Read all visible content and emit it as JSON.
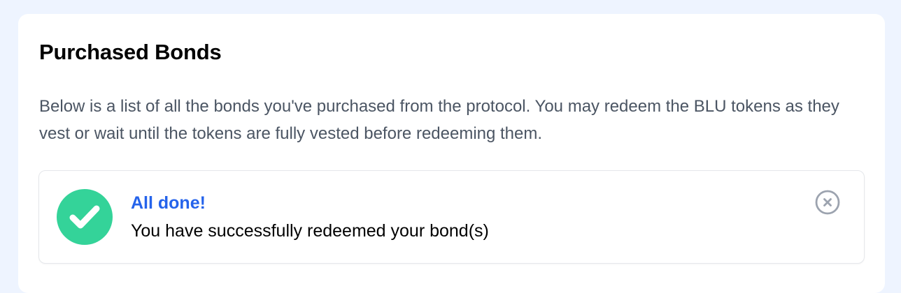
{
  "card": {
    "title": "Purchased Bonds",
    "description": "Below is a list of all the bonds you've purchased from the protocol. You may redeem the BLU tokens as they vest or wait until the tokens are fully vested before redeeming them."
  },
  "alert": {
    "icon": "check-circle-icon",
    "title": "All done!",
    "message": "You have successfully redeemed your bond(s)",
    "close_icon": "close-circle-icon"
  },
  "colors": {
    "page_background": "#eef4ff",
    "success": "#34d399",
    "alert_title": "#2563eb",
    "description_text": "#4b5563",
    "close_icon": "#9ca3af"
  }
}
